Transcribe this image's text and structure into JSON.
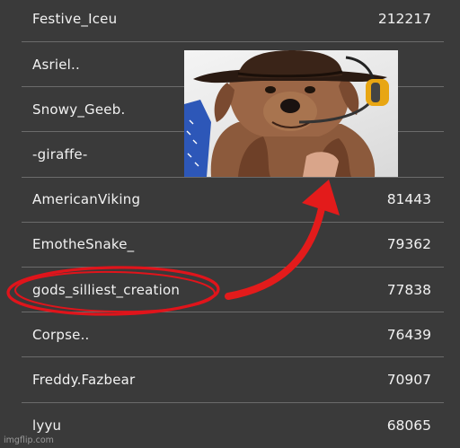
{
  "leaderboard": {
    "rows": [
      {
        "name": "Festive_Iceu",
        "score": "212217"
      },
      {
        "name": "Asriel..",
        "score": ""
      },
      {
        "name": "Snowy_Geeb.",
        "score": ""
      },
      {
        "name": "-giraffe-",
        "score": ""
      },
      {
        "name": "AmericanViking",
        "score": "81443"
      },
      {
        "name": "EmotheSnake_",
        "score": "79362"
      },
      {
        "name": "gods_silliest_creation",
        "score": "77838"
      },
      {
        "name": "Corpse..",
        "score": "76439"
      },
      {
        "name": "Freddy.Fazbear",
        "score": "70907"
      },
      {
        "name": "lyyu",
        "score": "68065"
      }
    ]
  },
  "annotation": {
    "highlighted_row": "gods_silliest_creation",
    "circle_color": "#e0141b",
    "arrow_color": "#e31b1b"
  },
  "meme_image": {
    "subject": "dog wearing cowboy hat and headset"
  },
  "watermark": "imgflip.com"
}
